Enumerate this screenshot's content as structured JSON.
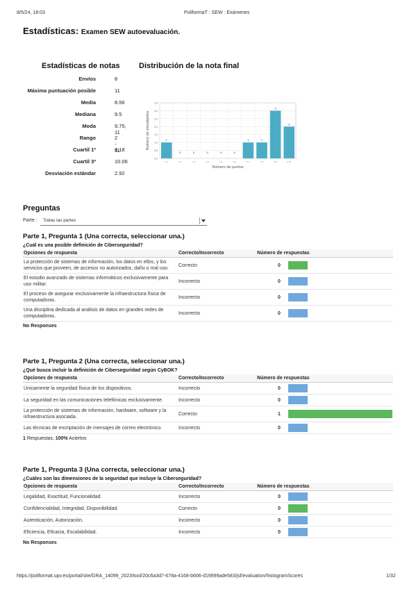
{
  "print_header": {
    "date": "8/5/24, 18:03",
    "title": "PoliformaT : SEW : Exámenes"
  },
  "print_footer": {
    "url": "https://poliformat.upv.es/portal/site/GRA_14099_2023/tool/20c6a3d7-678a-4168-b606-d19999ade583/jsf/evaluation/histogramScores",
    "page": "1/32"
  },
  "title": {
    "main": "Estadísticas:",
    "exam": "Examen SEW autoevaluación."
  },
  "stats_heading": "Estadísticas de notas",
  "stats": [
    {
      "label": "Envíos",
      "value": "8"
    },
    {
      "label": "Máxima puntuación posible",
      "value": "11"
    },
    {
      "label": "Media",
      "value": "8.56"
    },
    {
      "label": "Mediana",
      "value": "9.5"
    },
    {
      "label": "Moda",
      "value": "9.75, 11"
    },
    {
      "label": "Rango",
      "value": "2 - 11"
    },
    {
      "label": "Cuartil 1º",
      "value": "8.18"
    },
    {
      "label": "Cuartil 3º",
      "value": "10.06"
    },
    {
      "label": "Desviación estándar",
      "value": "2.92"
    }
  ],
  "dist_heading": "Distribución de la nota final",
  "chart_data": {
    "type": "bar",
    "title": "",
    "xlabel": "Número de puntos",
    "ylabel": "Número de estudiantes",
    "categories": [
      "0-1",
      "1-2",
      "2-3",
      "3-4",
      "4-5",
      "5-6",
      "6-7",
      "7-8",
      "8-9",
      "9-10"
    ],
    "values": [
      1,
      0,
      0,
      0,
      0,
      0,
      1,
      1,
      3,
      2
    ],
    "ylim": [
      0,
      3.5
    ],
    "yticks": [
      "0.0",
      "0.5",
      "1.0",
      "1.5",
      "2.0",
      "2.5",
      "3.0",
      "3.5"
    ],
    "color": "#4bacc6",
    "grid": true
  },
  "questions_heading": "Preguntas",
  "filter": {
    "label": "Parte :",
    "value": "Todas las partes"
  },
  "table_headers": {
    "option": "Opciones de respuesta",
    "correct": "Correcto/Incorrecto",
    "count": "Número de respuestas"
  },
  "questions": [
    {
      "title": "Parte 1, Pregunta 1 (Una correcta, seleccionar una.)",
      "text": "¿Cuál es una posible definición de Ciberseguridad?",
      "options": [
        {
          "text": "La protección de sistemas de información, los datos en ellos, y los servicios que proveen, de accesos no autorizados, daño o mal uso.",
          "result": "Correcto",
          "count": "0",
          "fill": 0
        },
        {
          "text": "El estudio avanzado de sistemas informáticos exclusivamente para uso militar.",
          "result": "Incorrecto",
          "count": "0",
          "fill": 0
        },
        {
          "text": "El proceso de asegurar exclusivamente la infraestructura física de computadoras.",
          "result": "Incorrecto",
          "count": "0",
          "fill": 0
        },
        {
          "text": "Una disciplina dedicada al análisis de datos en grandes redes de computadoras.",
          "result": "Incorrecto",
          "count": "0",
          "fill": 0
        }
      ],
      "footer_bold": "No Responses",
      "footer_rest": ""
    },
    {
      "title": "Parte 1, Pregunta 2 (Una correcta, seleccionar una.)",
      "text": "¿Qué busca incluir la definición de Ciberseguridad según CyBOK?",
      "options": [
        {
          "text": "Únicamente la seguridad física de los dispositivos.",
          "result": "Incorrecto",
          "count": "0",
          "fill": 0
        },
        {
          "text": "La seguridad en las comunicaciones telefónicas exclusivamente.",
          "result": "Incorrecto",
          "count": "0",
          "fill": 0
        },
        {
          "text": "La protección de sistemas de información, hardware, software y la infraestructura asociada.",
          "result": "Correcto",
          "count": "1",
          "fill": 1
        },
        {
          "text": "Las técnicas de encriptación de mensajes de correo electrónico.",
          "result": "Incorrecto",
          "count": "0",
          "fill": 0
        }
      ],
      "footer_bold": "1",
      "footer_rest": " Respuestas, ",
      "footer_bold2": "100%",
      "footer_rest2": " Aciertos"
    },
    {
      "title": "Parte 1, Pregunta 3 (Una correcta, seleccionar una.)",
      "text": "¿Cuáles son las dimensiones de la seguridad que incluye la Ciberseguridad?",
      "options": [
        {
          "text": "Legalidad, Exactitud, Funcionalidad.",
          "result": "Incorrecto",
          "count": "0",
          "fill": 0
        },
        {
          "text": "Confidencialidad, Integridad, Disponibilidad.",
          "result": "Correcto",
          "count": "0",
          "fill": 0
        },
        {
          "text": "Autenticación, Autorización.",
          "result": "Incorrecto",
          "count": "0",
          "fill": 0
        },
        {
          "text": "Eficiencia, Eficacia, Escalabilidad.",
          "result": "Incorrecto",
          "count": "0",
          "fill": 0
        }
      ],
      "footer_bold": "No Responses",
      "footer_rest": ""
    }
  ]
}
